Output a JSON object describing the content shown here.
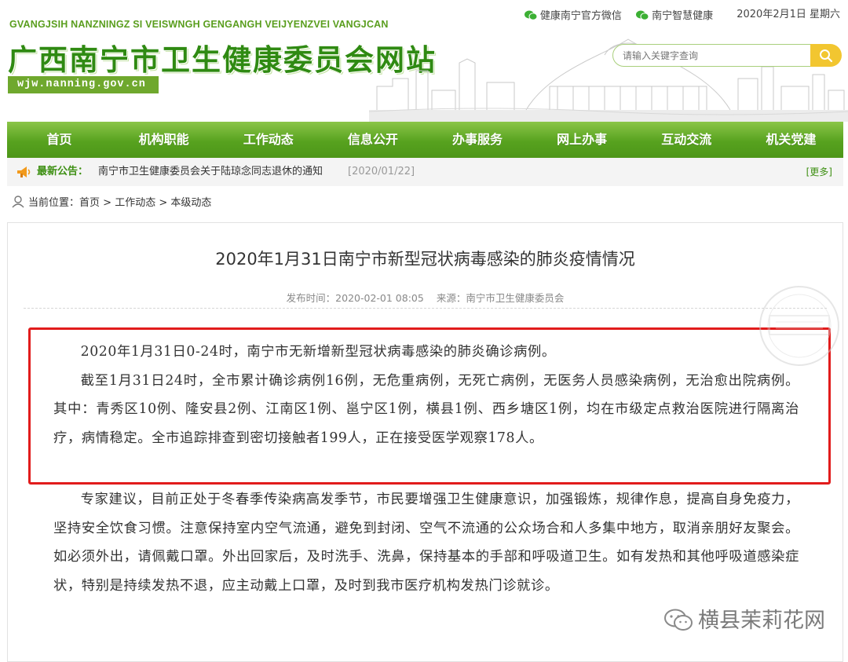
{
  "header": {
    "pinyin": "GVANGJSIH NANZNINGZ SI VEISWNGH GENGANGH VEIJYENZVEI VANGJCAN",
    "site_title": "广西南宁市卫生健康委员会网站",
    "domain": "wjw.nanning.gov.cn",
    "top_links": [
      {
        "label": "健康南宁官方微信",
        "icon": "wechat-icon"
      },
      {
        "label": "南宁智慧健康",
        "icon": "wechat-icon"
      }
    ],
    "date": "2020年2月1日 星期六",
    "search_placeholder": "请输入关键字查询",
    "search_icon": "search-icon"
  },
  "nav": {
    "items": [
      "首页",
      "机构职能",
      "工作动态",
      "信息公开",
      "办事服务",
      "网上办事",
      "互动交流",
      "机关党建"
    ]
  },
  "notice": {
    "label": "最新公告：",
    "text": "南宁市卫生健康委员会关于陆琼念同志退休的通知",
    "date": "[2020/01/22]",
    "more": "[更多]"
  },
  "breadcrumb": {
    "prefix": "当前位置：",
    "items": [
      "首页",
      "工作动态",
      "本级动态"
    ],
    "separator": " > "
  },
  "article": {
    "title": "2020年1月31日南宁市新型冠状病毒感染的肺炎疫情情况",
    "publish_time": "发布时间：2020-02-01 08:05",
    "source": "来源：南宁市卫生健康委员会",
    "paragraphs": [
      "2020年1月31日0-24时，南宁市无新增新型冠状病毒感染的肺炎确诊病例。",
      "截至1月31日24时，全市累计确诊病例16例，无危重病例，无死亡病例，无医务人员感染病例，无治愈出院病例。其中：青秀区10例、隆安县2例、江南区1例、邕宁区1例，横县1例、西乡塘区1例，均在市级定点救治医院进行隔离治疗，病情稳定。全市追踪排查到密切接触者199人，正在接受医学观察178人。",
      "专家建议，目前正处于冬春季传染病高发季节，市民要增强卫生健康意识，加强锻炼，规律作息，提高自身免疫力，坚持安全饮食习惯。注意保持室内空气流通，避免到封闭、空气不流通的公众场合和人多集中地方，取消亲朋好友聚会。如必须外出，请佩戴口罩。外出回家后，及时洗手、洗鼻，保持基本的手部和呼吸道卫生。如有发热和其他呼吸道感染症状，特别是持续发热不退，应主动戴上口罩，及时到我市医疗机构发热门诊就诊。"
    ]
  },
  "watermark": {
    "text": "横县茉莉花网",
    "icon": "wechat-icon"
  },
  "colors": {
    "brand_green": "#57a21f",
    "highlight_red": "#e11c1c",
    "search_button": "#f2c630"
  }
}
